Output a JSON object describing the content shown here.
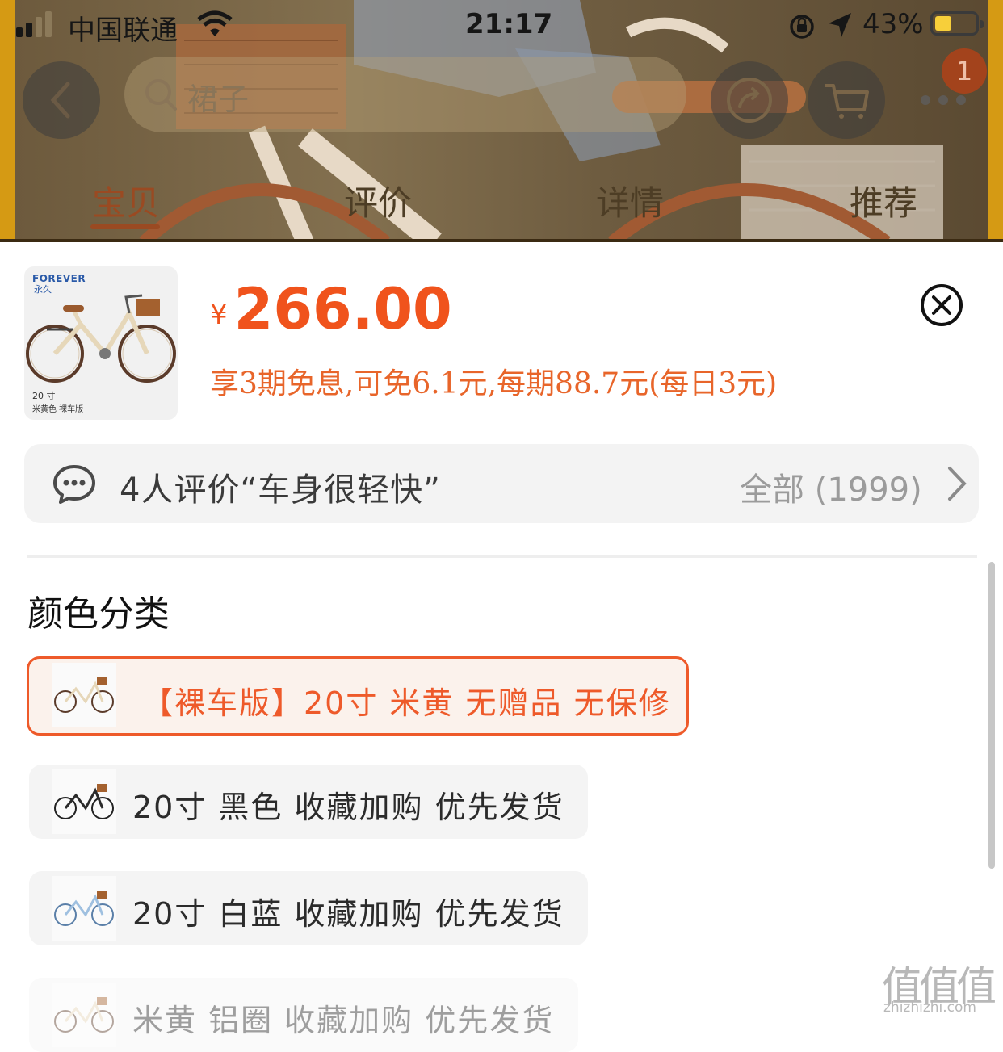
{
  "status_bar": {
    "carrier": "中国联通",
    "time": "21:17",
    "battery_percent": "43%",
    "battery_level": 0.43,
    "icons": [
      "signal-icon",
      "wifi-icon",
      "rotation-lock-icon",
      "location-icon",
      "battery-icon"
    ]
  },
  "nav": {
    "search_placeholder": "裙子",
    "cart_badge": "1",
    "icons": [
      "back-icon",
      "search-icon",
      "share-icon",
      "cart-icon",
      "more-icon"
    ]
  },
  "tabs": [
    {
      "label": "宝贝",
      "active": true
    },
    {
      "label": "评价",
      "active": false
    },
    {
      "label": "详情",
      "active": false
    },
    {
      "label": "推荐",
      "active": false
    }
  ],
  "product": {
    "currency": "¥",
    "price": "266.00",
    "installment": "享3期免息,可免6.1元,每期88.7元(每日3元)",
    "thumb_logo": "FOREVER",
    "thumb_logo_cn": "永久",
    "thumb_caption_size": "20 寸",
    "thumb_caption_variant": "米黄色 裸车版"
  },
  "review": {
    "summary": "4人评价“车身很轻快”",
    "all_label": "全部 (1999)"
  },
  "sku": {
    "section_title": "颜色分类",
    "options": [
      {
        "label": "【裸车版】20寸 米黄 无赠品 无保修",
        "selected": true
      },
      {
        "label": "20寸 黑色 收藏加购 优先发货",
        "selected": false
      },
      {
        "label": "20寸 白蓝 收藏加购 优先发货",
        "selected": false
      },
      {
        "label": "米黄 铝圈 收藏加购 优先发货",
        "selected": false
      }
    ]
  },
  "watermark": {
    "chars": "值值值",
    "url": "zhizhizhi.com"
  },
  "colors": {
    "accent": "#ee5a2a",
    "price": "#f0531c",
    "selected_bg": "#fbf2ec",
    "option_bg": "#f4f4f4"
  }
}
